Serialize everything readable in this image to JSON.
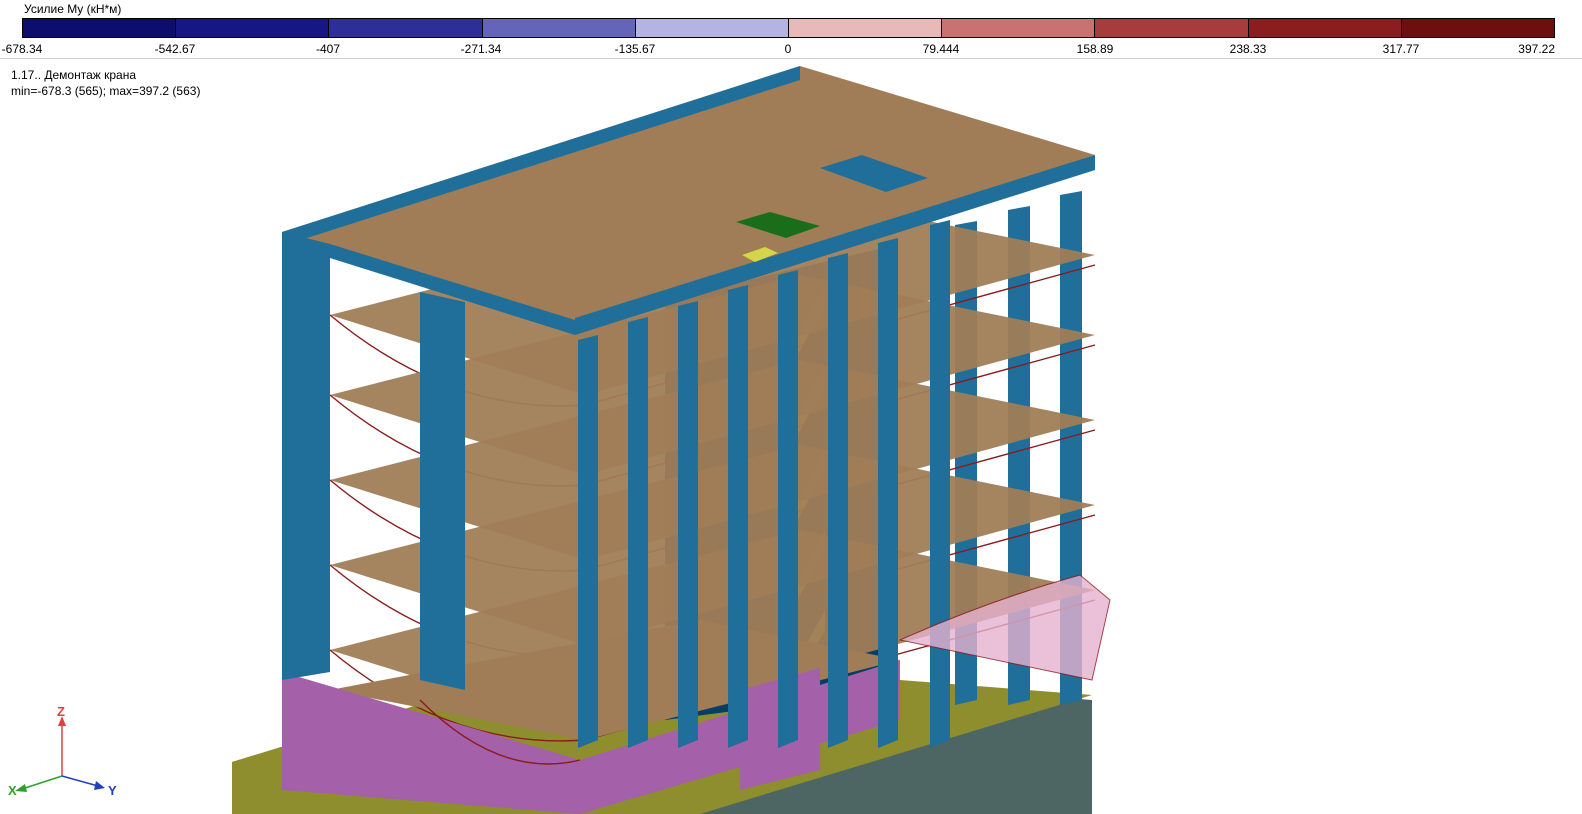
{
  "legend": {
    "title": "Усилие My (кН*м)",
    "segment_colors": [
      "#0d0d6e",
      "#161684",
      "#2e2e99",
      "#6464b8",
      "#b4b4e2",
      "#e7b9b9",
      "#c87272",
      "#a63c3c",
      "#8a1d1d",
      "#6e0f0f"
    ],
    "ticks": [
      "-678.34",
      "-542.67",
      "-407",
      "-271.34",
      "-135.67",
      "0",
      "79.444",
      "158.89",
      "238.33",
      "317.77",
      "397.22"
    ]
  },
  "info": {
    "load_case": "1.17.. Демонтаж крана",
    "minmax": "min=-678.3 (565); max=397.2 (563)"
  },
  "axes": {
    "z": "Z",
    "x": "X",
    "y": "Y"
  },
  "colors": {
    "column": "#1f6f9a",
    "slab": "#a07d57",
    "shaft": "#063f66",
    "stair": "#d5d54a",
    "wall_lower": "#a460a8",
    "foundation": "#8e8e2e",
    "ground": "#4d6663",
    "roof_hatch": "#1a6e1a",
    "moment_line": "#8b1a1a"
  }
}
